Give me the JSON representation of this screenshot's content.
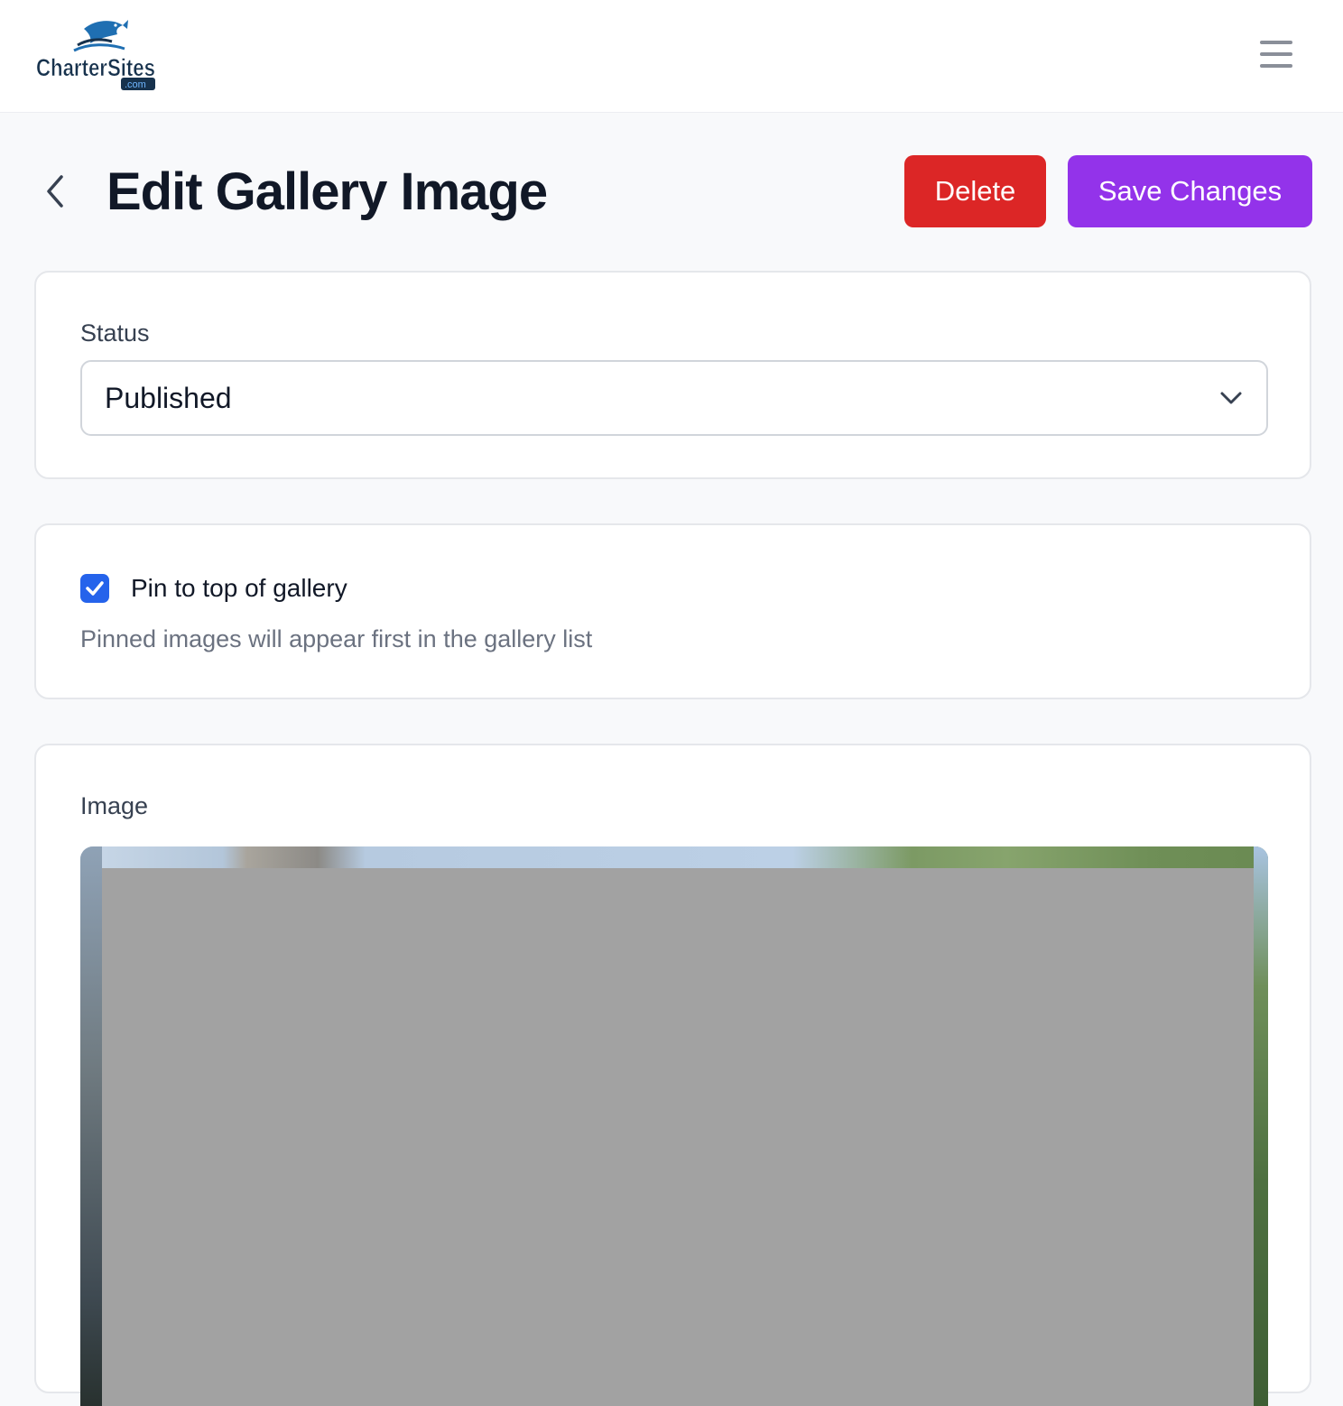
{
  "header": {
    "logo_text": "CharterSites",
    "logo_suffix": ".com",
    "menu_icon": "hamburger-menu-icon"
  },
  "page": {
    "title": "Edit Gallery Image",
    "back_icon": "chevron-left-icon",
    "delete_label": "Delete",
    "save_label": "Save Changes"
  },
  "status_card": {
    "label": "Status",
    "selected_value": "Published",
    "dropdown_icon": "chevron-down-icon"
  },
  "pin_card": {
    "checkbox_label": "Pin to top of gallery",
    "checked": true,
    "help_text": "Pinned images will appear first in the gallery list"
  },
  "image_card": {
    "label": "Image"
  },
  "colors": {
    "delete": "#dc2626",
    "save": "#9333ea",
    "checkbox": "#2563eb"
  }
}
